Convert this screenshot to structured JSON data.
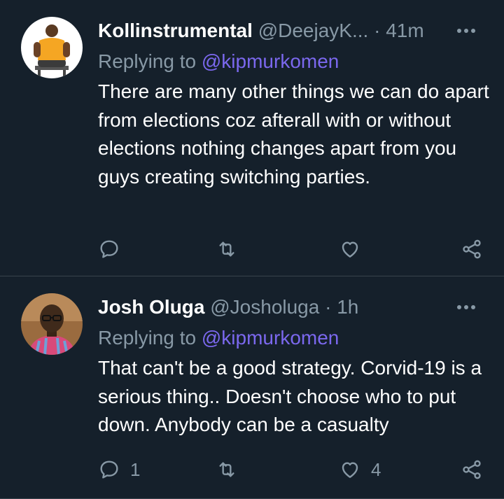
{
  "tweets": [
    {
      "display_name": "Kollinstrumental",
      "handle": "@DeejayK...",
      "separator": "·",
      "time": "41m",
      "reply_prefix": "Replying to",
      "reply_mention": "@kipmurkomen",
      "text": "There are many other things we can do apart from elections coz afterall with or without elections nothing changes apart from you guys creating switching parties.",
      "reply_count": "",
      "retweet_count": "",
      "like_count": "",
      "avatar": {
        "icon": "avatar-man-orange-shirt",
        "bg": "#ffffff",
        "shirt": "#f5a623"
      }
    },
    {
      "display_name": "Josh Oluga",
      "handle": "@Josholuga",
      "separator": "·",
      "time": "1h",
      "reply_prefix": "Replying to",
      "reply_mention": "@kipmurkomen",
      "text": "That can't be a good strategy. Corvid-19 is a serious thing.. Doesn't choose who to put down. Anybody can be a casualty",
      "reply_count": "1",
      "retweet_count": "",
      "like_count": "4",
      "avatar": {
        "icon": "avatar-man-glasses",
        "bg": "#9a6b3f",
        "shirt": "#d84a7a"
      }
    }
  ],
  "icons": {
    "reply": "reply-icon",
    "retweet": "retweet-icon",
    "like": "heart-icon",
    "share": "share-icon",
    "more": "more-icon"
  },
  "colors": {
    "background": "#15202b",
    "text": "#ffffff",
    "muted": "#8899a6",
    "mention": "#7b68ee",
    "divider": "#38444d"
  }
}
